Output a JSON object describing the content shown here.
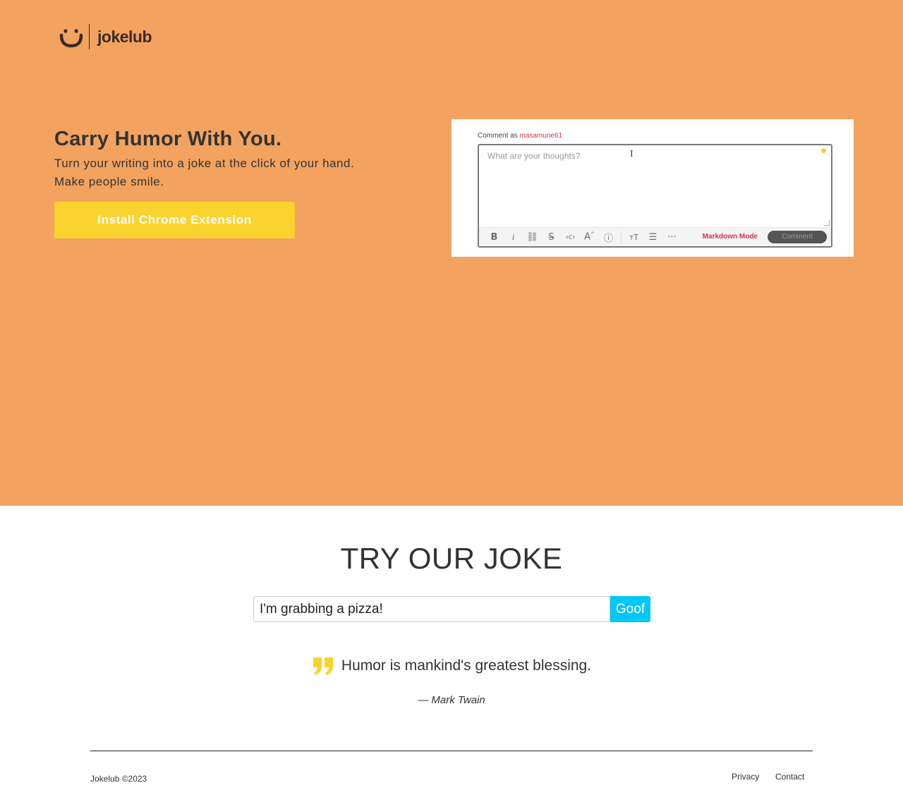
{
  "brand": {
    "name": "jokelub",
    "logo_icon": "smiley-icon"
  },
  "hero": {
    "headline": "Carry Humor With You.",
    "subline_1": "Turn your writing into a joke at the click of your hand.",
    "subline_2": "Make people smile.",
    "install_label": "Install Chrome Extension",
    "preview": {
      "comment_as": "Comment as ",
      "username": "masamune61",
      "placeholder": "What are your thoughts?",
      "toolbar_icons": [
        "bold-icon",
        "italic-icon",
        "link-icon",
        "strikethrough-icon",
        "code-icon",
        "superscript-icon",
        "spoiler-icon",
        "heading-icon",
        "bulleted-list-icon",
        "more-icon"
      ],
      "markdown_mode": "Markdown Mode",
      "comment_button": "Comment"
    }
  },
  "try": {
    "title": "TRY OUR JOKE",
    "input_value": "I'm grabbing a pizza!",
    "goof_label": "Goof"
  },
  "quote": {
    "text": "Humor is mankind's greatest blessing.",
    "author": "— Mark Twain"
  },
  "footer": {
    "copyright": "Jokelub ©2023",
    "links": [
      "Privacy",
      "Contact"
    ]
  },
  "colors": {
    "hero_bg": "#f3a35f",
    "accent_yellow": "#fbd32f",
    "goof_blue": "#00c8f8",
    "text_dark": "#333333"
  }
}
